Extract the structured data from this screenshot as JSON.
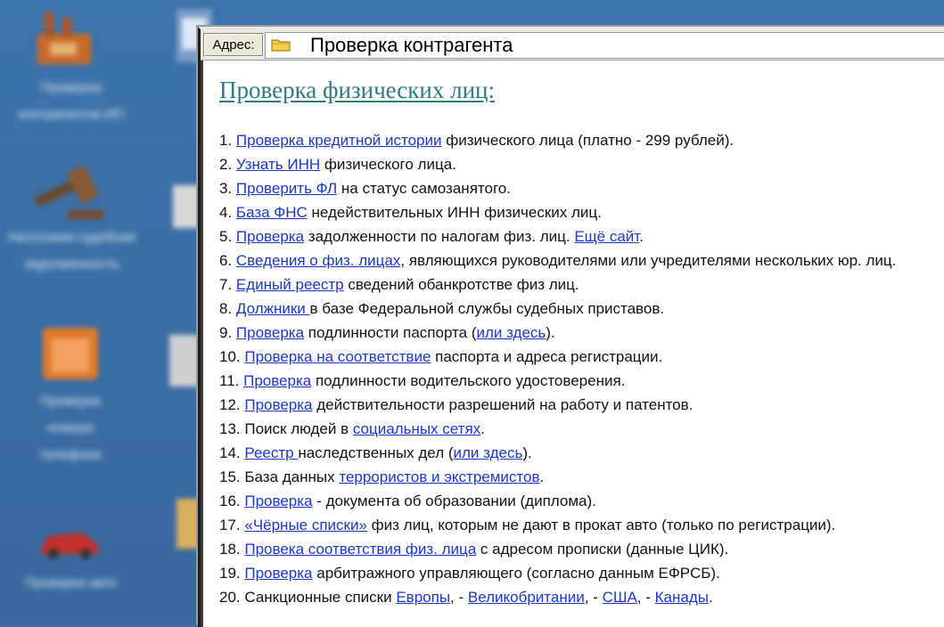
{
  "desktop": {
    "icons": [
      {
        "name": "desktop-icon-1",
        "label": "Проверка контрагентов ИП",
        "color": "#c86a2a"
      },
      {
        "name": "desktop-icon-2",
        "label": "Налоговая судебная задолженность",
        "color": "#8a5a34"
      },
      {
        "name": "desktop-icon-3",
        "label": "Проверка номера телефона",
        "color": "#e07a2a"
      },
      {
        "name": "desktop-icon-4",
        "label": "Проверка авто",
        "color": "#c4302a"
      }
    ]
  },
  "address_bar": {
    "label": "Адрес:",
    "value": "Проверка контрагента"
  },
  "page": {
    "heading": "Проверка физических лиц:",
    "items": [
      {
        "n": "1. ",
        "parts": [
          {
            "t": "Проверка кредитной истории",
            "link": true
          },
          {
            "t": " физического лица (платно - 299 рублей).",
            "link": false
          }
        ]
      },
      {
        "n": "2. ",
        "parts": [
          {
            "t": "Узнать ИНН",
            "link": true
          },
          {
            "t": " физического лица.",
            "link": false
          }
        ]
      },
      {
        "n": "3. ",
        "parts": [
          {
            "t": "Проверить ФЛ",
            "link": true
          },
          {
            "t": " на статус самозанятого.",
            "link": false
          }
        ]
      },
      {
        "n": "4. ",
        "parts": [
          {
            "t": "База ФНС",
            "link": true
          },
          {
            "t": " недействительных ИНН физических лиц.",
            "link": false
          }
        ]
      },
      {
        "n": "5. ",
        "parts": [
          {
            "t": "Проверка",
            "link": true
          },
          {
            "t": " задолженности по налогам физ. лиц. ",
            "link": false
          },
          {
            "t": "Ещё сайт",
            "link": true
          },
          {
            "t": ".",
            "link": false
          }
        ]
      },
      {
        "n": "6. ",
        "parts": [
          {
            "t": "Сведения о физ. лицах",
            "link": true
          },
          {
            "t": ", являющихся руководителями или учредителями нескольких юр. лиц.",
            "link": false
          }
        ]
      },
      {
        "n": "7. ",
        "parts": [
          {
            "t": "Единый реестр",
            "link": true
          },
          {
            "t": " сведений обанкротстве физ лиц.",
            "link": false
          }
        ]
      },
      {
        "n": "8. ",
        "parts": [
          {
            "t": "Должники ",
            "link": true
          },
          {
            "t": "в базе Федеральной службы судебных приставов.",
            "link": false
          }
        ]
      },
      {
        "n": "9. ",
        "parts": [
          {
            "t": "Проверка",
            "link": true
          },
          {
            "t": " подлинности паспорта (",
            "link": false
          },
          {
            "t": "или здесь",
            "link": true
          },
          {
            "t": ").",
            "link": false
          }
        ]
      },
      {
        "n": "10. ",
        "parts": [
          {
            "t": "Проверка на соответствие",
            "link": true
          },
          {
            "t": " паспорта и адреса регистрации.",
            "link": false
          }
        ]
      },
      {
        "n": "11. ",
        "parts": [
          {
            "t": "Проверка",
            "link": true
          },
          {
            "t": " подлинности водительского удостоверения.",
            "link": false
          }
        ]
      },
      {
        "n": "12. ",
        "parts": [
          {
            "t": "Проверка",
            "link": true
          },
          {
            "t": " действительности разрешений на работу и патентов.",
            "link": false
          }
        ]
      },
      {
        "n": "13. ",
        "parts": [
          {
            "t": "Поиск людей в ",
            "link": false
          },
          {
            "t": "социальных сетях",
            "link": true
          },
          {
            "t": ".",
            "link": false
          }
        ]
      },
      {
        "n": "14. ",
        "parts": [
          {
            "t": "Реестр ",
            "link": true
          },
          {
            "t": "наследственных дел (",
            "link": false
          },
          {
            "t": "или здесь",
            "link": true
          },
          {
            "t": ").",
            "link": false
          }
        ]
      },
      {
        "n": "15. ",
        "parts": [
          {
            "t": "База данных ",
            "link": false
          },
          {
            "t": "террористов и экстремистов",
            "link": true
          },
          {
            "t": ".",
            "link": false
          }
        ]
      },
      {
        "n": "16. ",
        "parts": [
          {
            "t": "Проверка",
            "link": true
          },
          {
            "t": " - документа об образовании (диплома).",
            "link": false
          }
        ]
      },
      {
        "n": "17. ",
        "parts": [
          {
            "t": "«Чёрные списки»",
            "link": true
          },
          {
            "t": " физ лиц, которым не дают в прокат авто (только по регистрации).",
            "link": false
          }
        ]
      },
      {
        "n": "18. ",
        "parts": [
          {
            "t": "Провека соответствия физ. лица",
            "link": true
          },
          {
            "t": " с адресом прописки (данные ЦИК).",
            "link": false
          }
        ]
      },
      {
        "n": "19. ",
        "parts": [
          {
            "t": "Проверка",
            "link": true
          },
          {
            "t": " арбитражного управляющего (согласно данным ЕФРСБ).",
            "link": false
          }
        ]
      },
      {
        "n": "20. ",
        "parts": [
          {
            "t": "Санкционные списки ",
            "link": false
          },
          {
            "t": "Европы",
            "link": true
          },
          {
            "t": ", - ",
            "link": false
          },
          {
            "t": "Великобритании",
            "link": true
          },
          {
            "t": ", - ",
            "link": false
          },
          {
            "t": "США",
            "link": true
          },
          {
            "t": ", - ",
            "link": false
          },
          {
            "t": "Канады",
            "link": true
          },
          {
            "t": ".",
            "link": false
          }
        ]
      }
    ]
  },
  "colors": {
    "link": "#1a37c8",
    "heading": "#2e7b7e",
    "desktop": "#3a6ea5"
  }
}
